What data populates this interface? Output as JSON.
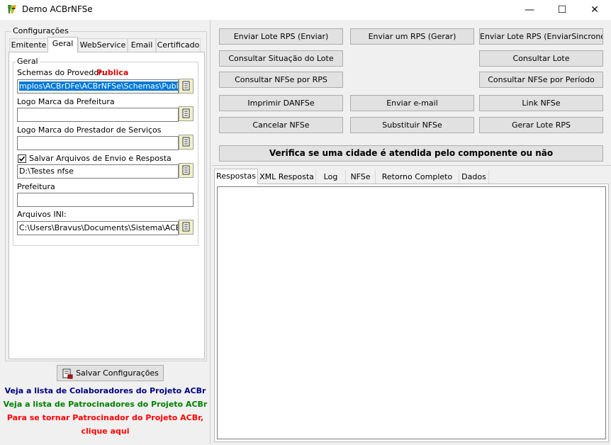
{
  "window": {
    "title": "Demo ACBrNFSe",
    "minimize_glyph": "—",
    "maximize_glyph": "☐",
    "close_glyph": "✕"
  },
  "config": {
    "group_title": "Configurações",
    "tabs": [
      "Emitente",
      "Geral",
      "WebService",
      "Email",
      "Certificado"
    ],
    "active_tab": "Geral",
    "geral": {
      "group_title": "Geral",
      "schemas_label": "Schemas do Provedor:",
      "schemas_provider": "Publica",
      "schemas_path": "mplos\\ACBrDFe\\ACBrNFSe\\Schemas\\Publica",
      "logo_prefeitura_label": "Logo Marca da Prefeitura",
      "logo_prefeitura_value": "",
      "logo_prestador_label": "Logo Marca do Prestador de Serviços",
      "logo_prestador_value": "",
      "salvar_label": "Salvar Arquivos de Envio e Resposta",
      "salvar_checked": true,
      "salvar_path": "D:\\Testes nfse",
      "prefeitura_label": "Prefeitura",
      "prefeitura_value": "",
      "arquivos_ini_label": "Arquivos INI:",
      "arquivos_ini_value": "C:\\Users\\Bravus\\Documents\\Sistema\\ACBR\\"
    },
    "save_button": "Salvar Configurações",
    "links": {
      "colaboradores": "Veja a lista de Colaboradores do Projeto ACBr",
      "patrocinadores": "Veja a lista de Patrocinadores do Projeto ACBr",
      "tornar_line1": "Para se tornar Patrocinador do Projeto ACBr,",
      "tornar_line2": "clique aqui"
    },
    "colors": {
      "provider": "#e00000",
      "colaboradores": "#000080",
      "patrocinadores": "#008000",
      "tornar": "#ff0000"
    }
  },
  "actions": {
    "enviar_lote": "Enviar Lote RPS (Enviar)",
    "enviar_um": "Enviar um RPS (Gerar)",
    "enviar_sincrono": "Enviar Lote RPS (EnviarSincrono)",
    "consultar_situacao": "Consultar Situação do Lote",
    "consultar_lote": "Consultar Lote",
    "consultar_por_rps": "Consultar NFSe por RPS",
    "consultar_por_periodo": "Consultar NFSe por Período",
    "imprimir": "Imprimir DANFSe",
    "enviar_email": "Enviar e-mail",
    "link_nfse": "Link NFSe",
    "cancelar": "Cancelar NFSe",
    "substituir": "Substituir NFSe",
    "gerar_lote": "Gerar Lote RPS",
    "verifica_cidade": "Verifica se uma cidade é atendida pelo componente ou não"
  },
  "result_tabs": [
    "Respostas",
    "XML Resposta",
    "Log",
    "NFSe",
    "Retorno Completo WS",
    "Dados"
  ],
  "active_result_tab": "Respostas"
}
